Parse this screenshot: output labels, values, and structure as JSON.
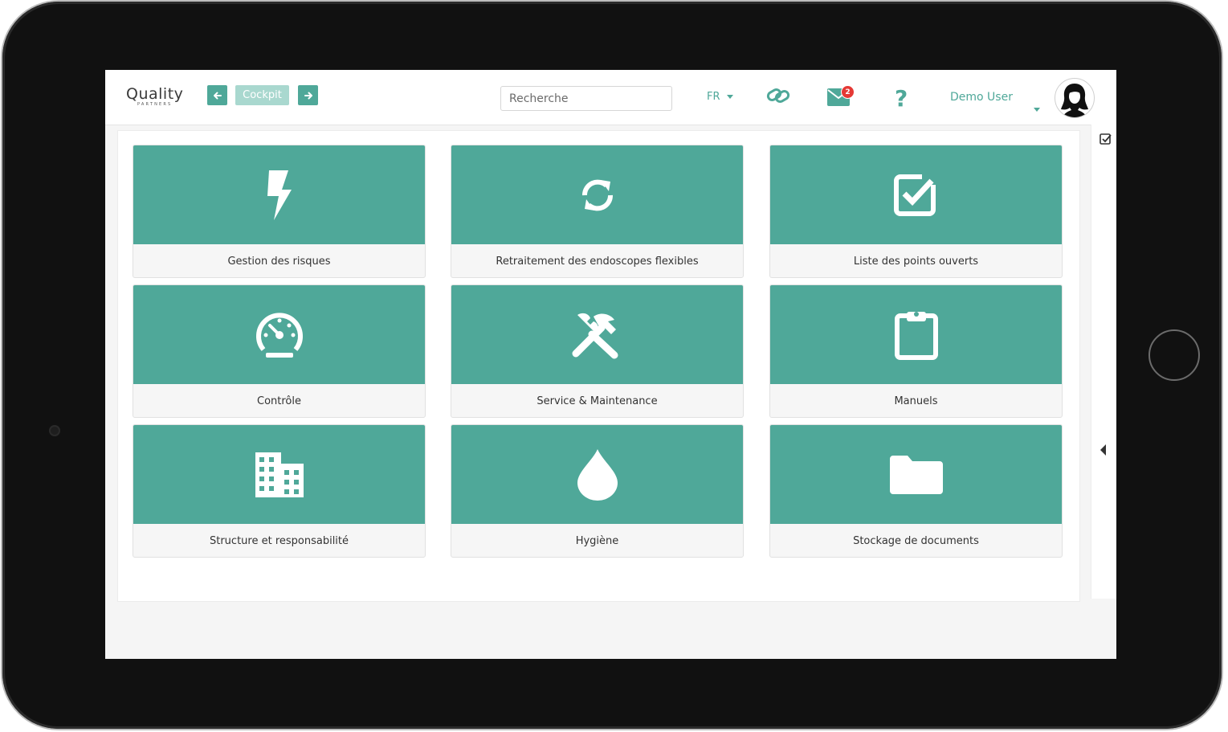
{
  "header": {
    "logo_text": "Quality",
    "logo_sub": "PARTNERS",
    "back_icon": "arrow-left-icon",
    "cockpit_label": "Cockpit",
    "forward_icon": "arrow-right-icon",
    "search_placeholder": "Recherche",
    "language": "FR",
    "link_icon": "link-icon",
    "mail_icon": "envelope-icon",
    "mail_badge": "2",
    "help_label": "?",
    "user_name": "Demo User"
  },
  "tiles": [
    {
      "label": "Gestion des risques",
      "icon": "bolt-icon"
    },
    {
      "label": "Retraitement des endoscopes flexibles",
      "icon": "sync-icon"
    },
    {
      "label": "Liste des points ouverts",
      "icon": "checkbox-icon"
    },
    {
      "label": "Contrôle",
      "icon": "gauge-icon"
    },
    {
      "label": "Service & Maintenance",
      "icon": "tools-icon"
    },
    {
      "label": "Manuels",
      "icon": "clipboard-icon"
    },
    {
      "label": "Structure et responsabilité",
      "icon": "building-icon"
    },
    {
      "label": "Hygiène",
      "icon": "drop-icon"
    },
    {
      "label": "Stockage de documents",
      "icon": "folder-icon"
    }
  ],
  "sidebar": {
    "check_icon": "checkbox-small-icon",
    "toggle_icon": "caret-left-icon"
  },
  "colors": {
    "accent": "#4fa899",
    "accent_light": "#a9d8cf",
    "badge": "#e53935"
  }
}
